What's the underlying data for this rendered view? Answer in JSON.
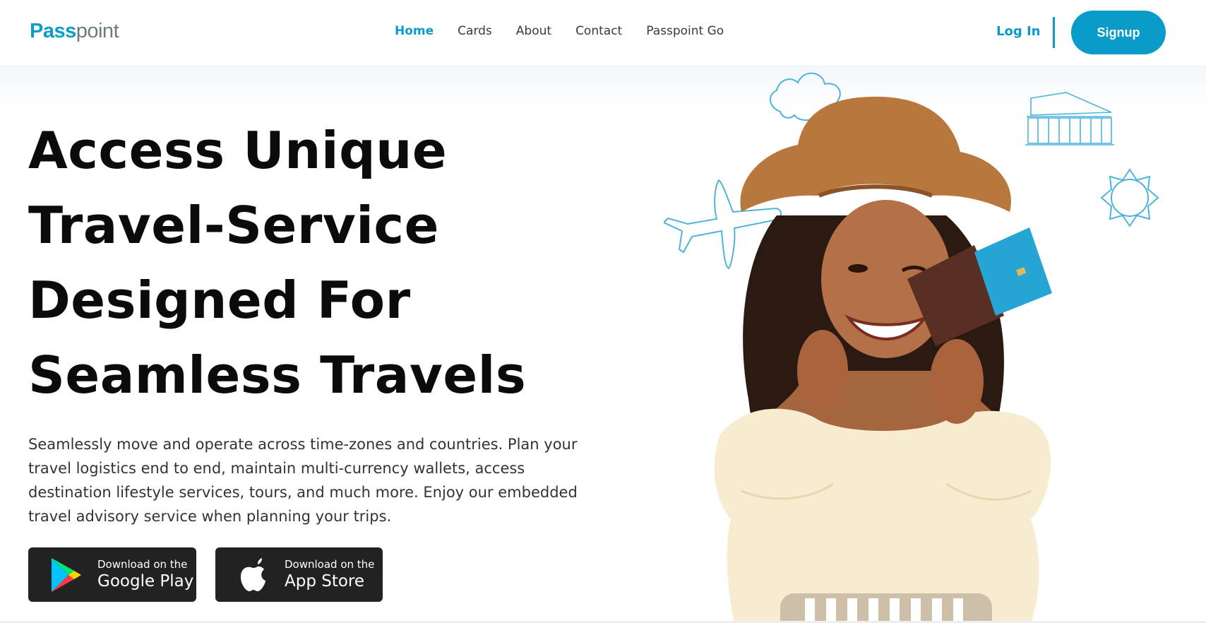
{
  "header": {
    "logo_part1": "Pass",
    "logo_part2": "point",
    "nav": [
      "Home",
      "Cards",
      "About",
      "Contact",
      "Passpoint Go"
    ],
    "login_label": "Log In",
    "signup_label": "Signup"
  },
  "hero": {
    "headline": [
      "Access Unique",
      "Travel-Service",
      "Designed For",
      "Seamless Travels"
    ],
    "description": "Seamlessly move and operate across time-zones and countries. Plan your travel logistics end to end, maintain multi-currency wallets, access destination lifestyle services, tours, and much more. Enjoy our embedded travel advisory service when planning your trips.",
    "google_play": {
      "line1": "Download on the",
      "line2": "Google Play",
      "icon": "google-play-icon"
    },
    "app_store": {
      "line1": "Download on the",
      "line2": "App Store",
      "icon": "apple-icon"
    }
  },
  "colors": {
    "accent": "#0a9bc9",
    "dark_button": "#222222",
    "text": "#0b0b0b"
  }
}
